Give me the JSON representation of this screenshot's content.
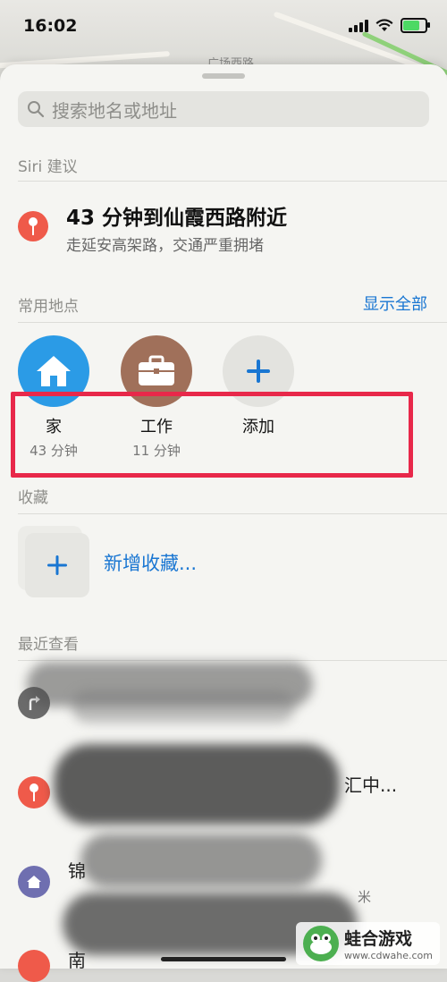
{
  "status_bar": {
    "time": "16:02"
  },
  "map": {
    "road_label": "广场西路"
  },
  "search": {
    "placeholder": "搜索地名或地址"
  },
  "siri": {
    "header": "Siri 建议",
    "title": "43 分钟到仙霞西路附近",
    "subtitle": "走延安高架路，交通严重拥堵"
  },
  "favorites": {
    "header": "常用地点",
    "show_all": "显示全部",
    "items": [
      {
        "name": "家",
        "eta": "43 分钟",
        "color": "#2b9be6",
        "icon": "house-icon"
      },
      {
        "name": "工作",
        "eta": "11 分钟",
        "color": "#a0705a",
        "icon": "briefcase-icon"
      },
      {
        "name": "添加",
        "eta": "",
        "color": "#e3e3df",
        "icon": "plus-icon"
      }
    ]
  },
  "collections": {
    "header": "收藏",
    "new_label": "新增收藏..."
  },
  "recent": {
    "header": "最近查看",
    "items": [
      {
        "title": "",
        "subtitle": "",
        "icon": "turn-arrow-icon",
        "color": "#6b6b6b"
      },
      {
        "title": "汇中...",
        "subtitle": "",
        "icon": "pin-icon",
        "color": "#ef5a4a"
      },
      {
        "title": "锦",
        "subtitle": "米",
        "icon": "home-building-icon",
        "color": "#6f6fb0"
      },
      {
        "title": "南",
        "subtitle": "",
        "icon": "pin-icon",
        "color": "#ef5a4a"
      }
    ]
  },
  "watermark": {
    "title": "蛙合游戏",
    "url": "www.cdwahe.com"
  }
}
